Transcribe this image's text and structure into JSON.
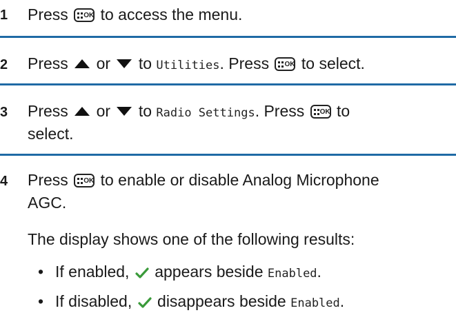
{
  "steps": [
    {
      "number": "1",
      "press": "Press",
      "tail": "to access the menu.",
      "key_icon": "menu-ok-key-icon"
    },
    {
      "number": "2",
      "press": "Press",
      "or": "or",
      "to": "to",
      "target": "Utilities",
      "press2": ". Press",
      "tail": "to select.",
      "up_icon": "up-arrow-icon",
      "down_icon": "down-arrow-icon",
      "key_icon": "menu-ok-key-icon"
    },
    {
      "number": "3",
      "press": "Press",
      "or": "or",
      "to": "to",
      "target": "Radio Settings",
      "press2": ". Press",
      "tail_line1": "to",
      "tail_line2": "select.",
      "up_icon": "up-arrow-icon",
      "down_icon": "down-arrow-icon",
      "key_icon": "menu-ok-key-icon"
    },
    {
      "number": "4",
      "press": "Press",
      "tail_line1": "to enable or disable Analog Microphone",
      "tail_line2": "AGC.",
      "key_icon": "menu-ok-key-icon"
    }
  ],
  "result_intro": "The display shows one of the following results:",
  "results": [
    {
      "bullet": "•",
      "prefix": "If enabled,",
      "middle": "appears beside",
      "value": "Enabled",
      "suffix": "."
    },
    {
      "bullet": "•",
      "prefix": "If disabled,",
      "middle": "disappears beside",
      "value": "Enabled",
      "suffix": "."
    }
  ],
  "colors": {
    "divider": "#1f6aa5",
    "check": "#3a9a3a",
    "text": "#1a1a1a"
  }
}
